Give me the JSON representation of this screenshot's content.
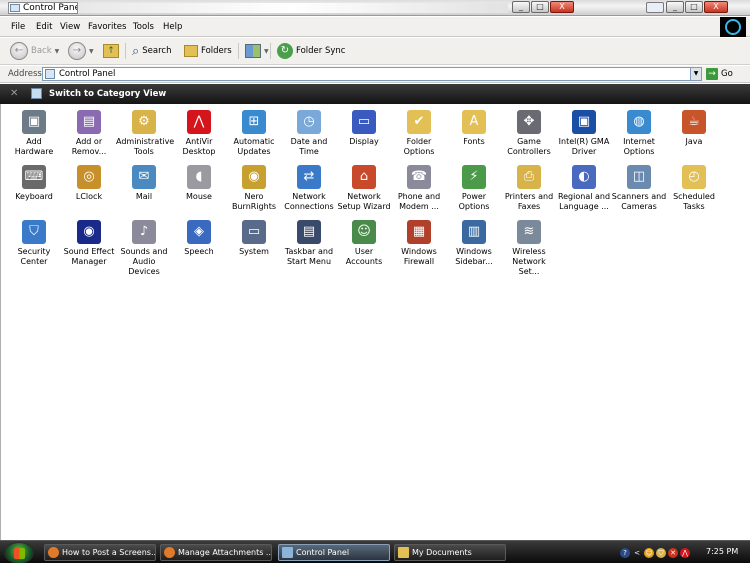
{
  "window": {
    "title": "Control Panel",
    "buttons": {
      "minimize": "_",
      "maximize": "□",
      "close": "X"
    }
  },
  "menu": [
    "File",
    "Edit",
    "View",
    "Favorites",
    "Tools",
    "Help"
  ],
  "toolbar": {
    "back": "Back",
    "search": "Search",
    "folders": "Folders",
    "folder_sync": "Folder Sync"
  },
  "address": {
    "label": "Address",
    "value": "Control Panel",
    "go": "Go"
  },
  "category_bar": {
    "label": "Switch to Category View"
  },
  "items": [
    {
      "label": "Add Hardware",
      "icon": "add-hardware-icon",
      "color": "#6d7b88",
      "glyph": "▣"
    },
    {
      "label": "Add or Remov...",
      "icon": "add-remove-programs-icon",
      "color": "#8a6ab0",
      "glyph": "▤"
    },
    {
      "label": "Administrative Tools",
      "icon": "administrative-tools-icon",
      "color": "#d8b34a",
      "glyph": "⚙"
    },
    {
      "label": "AntiVir Desktop",
      "icon": "antivir-icon",
      "color": "#d4161c",
      "glyph": "⋀"
    },
    {
      "label": "Automatic Updates",
      "icon": "automatic-updates-icon",
      "color": "#3a8ad0",
      "glyph": "⊞"
    },
    {
      "label": "Date and Time",
      "icon": "date-time-icon",
      "color": "#7aa8d8",
      "glyph": "◷"
    },
    {
      "label": "Display",
      "icon": "display-icon",
      "color": "#3a5ac0",
      "glyph": "▭"
    },
    {
      "label": "Folder Options",
      "icon": "folder-options-icon",
      "color": "#e3c055",
      "glyph": "✔"
    },
    {
      "label": "Fonts",
      "icon": "fonts-icon",
      "color": "#e3c055",
      "glyph": "A"
    },
    {
      "label": "Game Controllers",
      "icon": "game-controllers-icon",
      "color": "#6a6a72",
      "glyph": "✥"
    },
    {
      "label": "Intel(R) GMA Driver",
      "icon": "intel-gma-icon",
      "color": "#1b4fa6",
      "glyph": "▣"
    },
    {
      "label": "Internet Options",
      "icon": "internet-options-icon",
      "color": "#3a8ad0",
      "glyph": "◍"
    },
    {
      "label": "Java",
      "icon": "java-icon",
      "color": "#c8542a",
      "glyph": "☕"
    },
    {
      "label": "Keyboard",
      "icon": "keyboard-icon",
      "color": "#6a6a6a",
      "glyph": "⌨"
    },
    {
      "label": "LClock",
      "icon": "lclock-icon",
      "color": "#c8902a",
      "glyph": "◎"
    },
    {
      "label": "Mail",
      "icon": "mail-icon",
      "color": "#4a8ac0",
      "glyph": "✉"
    },
    {
      "label": "Mouse",
      "icon": "mouse-icon",
      "color": "#9a9aa0",
      "glyph": "◖"
    },
    {
      "label": "Nero BurnRights",
      "icon": "nero-burnrights-icon",
      "color": "#c8a030",
      "glyph": "◉"
    },
    {
      "label": "Network Connections",
      "icon": "network-connections-icon",
      "color": "#3a7ac8",
      "glyph": "⇄"
    },
    {
      "label": "Network Setup Wizard",
      "icon": "network-setup-wizard-icon",
      "color": "#c84a2a",
      "glyph": "⌂"
    },
    {
      "label": "Phone and Modem ...",
      "icon": "phone-modem-icon",
      "color": "#8a8a9a",
      "glyph": "☎"
    },
    {
      "label": "Power Options",
      "icon": "power-options-icon",
      "color": "#4a9a4a",
      "glyph": "⚡"
    },
    {
      "label": "Printers and Faxes",
      "icon": "printers-faxes-icon",
      "color": "#d8b34a",
      "glyph": "⎙"
    },
    {
      "label": "Regional and Language ...",
      "icon": "regional-language-icon",
      "color": "#4a6ac0",
      "glyph": "◐"
    },
    {
      "label": "Scanners and Cameras",
      "icon": "scanners-cameras-icon",
      "color": "#6a8ab0",
      "glyph": "◫"
    },
    {
      "label": "Scheduled Tasks",
      "icon": "scheduled-tasks-icon",
      "color": "#e3c055",
      "glyph": "◴"
    },
    {
      "label": "Security Center",
      "icon": "security-center-icon",
      "color": "#3a7ac8",
      "glyph": "⛉"
    },
    {
      "label": "Sound Effect Manager",
      "icon": "sound-effect-manager-icon",
      "color": "#1a2a8a",
      "glyph": "◉"
    },
    {
      "label": "Sounds and Audio Devices",
      "icon": "sounds-audio-icon",
      "color": "#8a8a9a",
      "glyph": "♪"
    },
    {
      "label": "Speech",
      "icon": "speech-icon",
      "color": "#3a6ac0",
      "glyph": "◈"
    },
    {
      "label": "System",
      "icon": "system-icon",
      "color": "#5a6a8a",
      "glyph": "▭"
    },
    {
      "label": "Taskbar and Start Menu",
      "icon": "taskbar-start-menu-icon",
      "color": "#3a4a6a",
      "glyph": "▤"
    },
    {
      "label": "User Accounts",
      "icon": "user-accounts-icon",
      "color": "#4a8a4a",
      "glyph": "☺"
    },
    {
      "label": "Windows Firewall",
      "icon": "windows-firewall-icon",
      "color": "#b0402a",
      "glyph": "▦"
    },
    {
      "label": "Windows Sidebar...",
      "icon": "windows-sidebar-icon",
      "color": "#3a6aa0",
      "glyph": "▥"
    },
    {
      "label": "Wireless Network Set...",
      "icon": "wireless-network-icon",
      "color": "#7a8a9a",
      "glyph": "≋"
    }
  ],
  "taskbar": {
    "buttons": [
      {
        "label": "How to Post a Screens...",
        "icon": "firefox-icon",
        "color": "#e07a2a",
        "active": false
      },
      {
        "label": "Manage Attachments ...",
        "icon": "firefox-icon",
        "color": "#e07a2a",
        "active": false
      },
      {
        "label": "Control Panel",
        "icon": "control-panel-icon",
        "color": "#8ab4d8",
        "active": true
      },
      {
        "label": "My Documents",
        "icon": "folder-icon",
        "color": "#e3c055",
        "active": false
      }
    ],
    "tray": [
      "?",
      "<",
      "☺",
      "⛉",
      "✕",
      "⋀"
    ],
    "time": "7:25 PM"
  }
}
